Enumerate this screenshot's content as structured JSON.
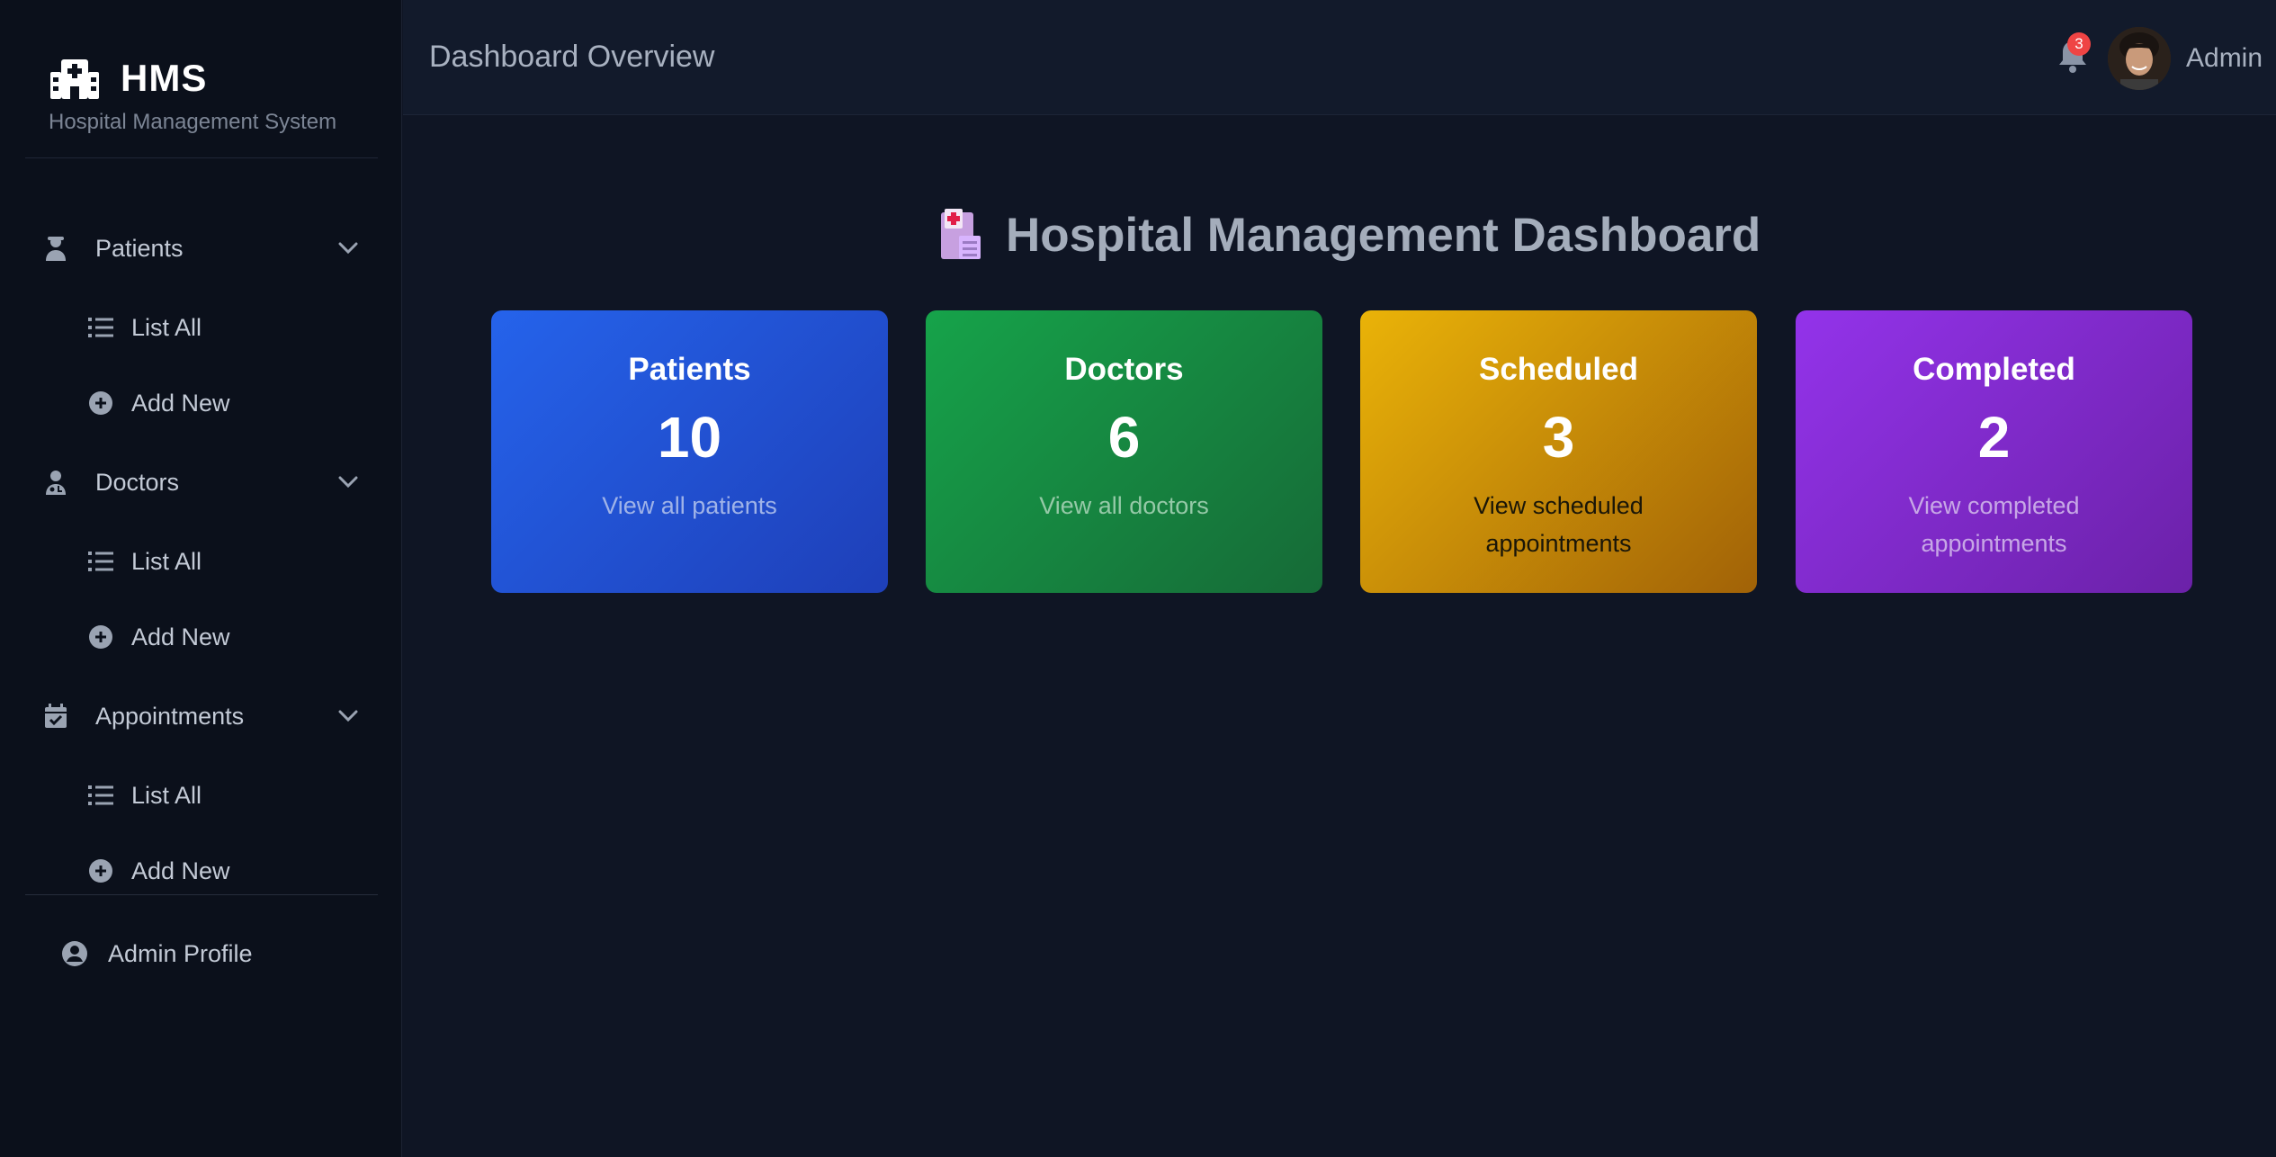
{
  "brand": {
    "title": "HMS",
    "subtitle": "Hospital Management System",
    "icon": "hospital-icon"
  },
  "sidebar": {
    "sections": [
      {
        "label": "Patients",
        "icon": "patient-icon",
        "items": [
          {
            "label": "List All",
            "icon": "list-icon"
          },
          {
            "label": "Add New",
            "icon": "plus-circle-icon"
          }
        ]
      },
      {
        "label": "Doctors",
        "icon": "doctor-icon",
        "items": [
          {
            "label": "List All",
            "icon": "list-icon"
          },
          {
            "label": "Add New",
            "icon": "plus-circle-icon"
          }
        ]
      },
      {
        "label": "Appointments",
        "icon": "calendar-check-icon",
        "items": [
          {
            "label": "List All",
            "icon": "list-icon"
          },
          {
            "label": "Add New",
            "icon": "plus-circle-icon"
          }
        ]
      }
    ],
    "profile_link": "Admin Profile"
  },
  "header": {
    "title": "Dashboard Overview",
    "notification_count": "3",
    "user_name": "Admin"
  },
  "main": {
    "title": "Hospital Management Dashboard",
    "cards": [
      {
        "title": "Patients",
        "value": "10",
        "link": "View all patients",
        "color": "#2563eb"
      },
      {
        "title": "Doctors",
        "value": "6",
        "link": "View all doctors",
        "color": "#16a34a"
      },
      {
        "title": "Scheduled",
        "value": "3",
        "link": "View scheduled appointments",
        "color": "#eab308"
      },
      {
        "title": "Completed",
        "value": "2",
        "link": "View completed appointments",
        "color": "#9333ea"
      }
    ]
  },
  "colors": {
    "background": "#0f1524",
    "sidebar": "#0b101b",
    "header": "#121a2b",
    "badge": "#ef4444"
  }
}
